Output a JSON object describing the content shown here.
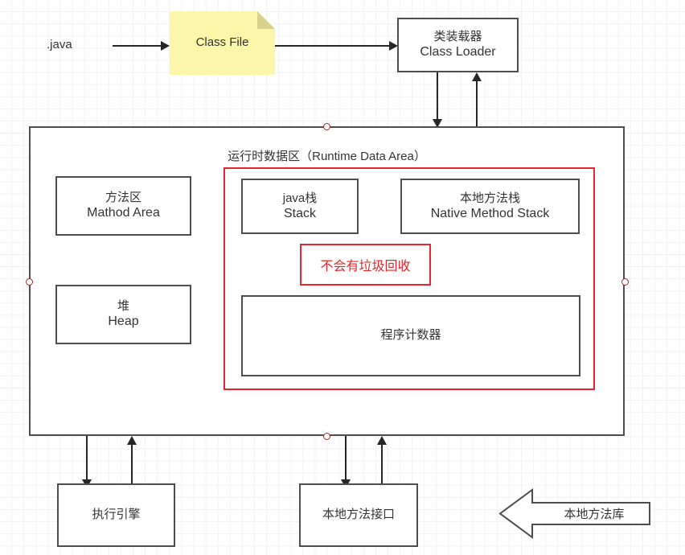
{
  "diagram": {
    "title": "JVM Runtime Data Area Architecture",
    "colors": {
      "node_stroke": "#4d4d4d",
      "note_fill": "#fcf7a8",
      "note_fold": "#d9d28a",
      "accent_red": "#e8252a",
      "handle_red": "#9c2a2a",
      "text": "#333333",
      "grid": "#f2f2f2",
      "background": "#ffffff"
    }
  },
  "source_label": ".java",
  "class_file": {
    "label": "Class File"
  },
  "class_loader": {
    "cn": "类装载器",
    "en": "Class Loader"
  },
  "runtime_area": {
    "title": "运行时数据区（Runtime Data Area）",
    "method_area": {
      "cn": "方法区",
      "en": "Mathod Area"
    },
    "heap": {
      "cn": "堆",
      "en": "Heap"
    },
    "java_stack": {
      "cn": "java栈",
      "en": "Stack"
    },
    "native_method_stack": {
      "cn": "本地方法栈",
      "en": "Native Method Stack"
    },
    "program_counter": {
      "cn": "程序计数器"
    },
    "gc_note": "不会有垃圾回收"
  },
  "execution_engine": {
    "cn": "执行引擎"
  },
  "native_method_interface": {
    "cn": "本地方法接口"
  },
  "native_method_library": {
    "cn": "本地方法库"
  }
}
